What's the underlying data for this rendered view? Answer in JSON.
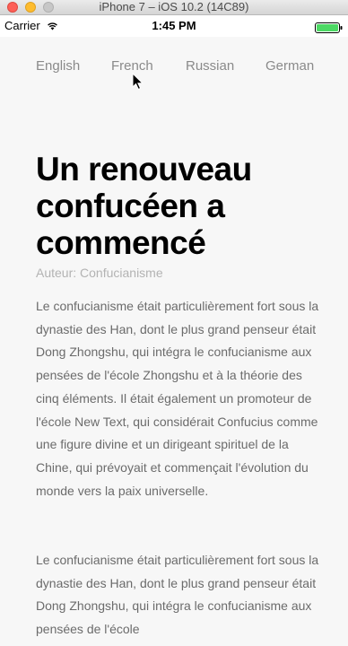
{
  "window": {
    "title": "iPhone 7 – iOS 10.2 (14C89)"
  },
  "status_bar": {
    "carrier": "Carrier",
    "time": "1:45 PM"
  },
  "languages": [
    "English",
    "French",
    "Russian",
    "German"
  ],
  "article": {
    "title": "Un renouveau confucéen a commencé",
    "author": "Auteur: Confucianisme",
    "paragraphs": [
      "Le confucianisme était particulièrement fort sous la dynastie des Han, dont le plus grand penseur était Dong Zhongshu, qui intégra le confucianisme aux pensées de l'école Zhongshu et à la théorie des cinq éléments. Il était également un promoteur de l'école New Text, qui considérait Confucius comme une figure divine et un dirigeant spirituel de la Chine, qui prévoyait et commençait l'évolution du monde vers la paix universelle.",
      "Le confucianisme était particulièrement fort sous la dynastie des Han, dont le plus grand penseur était Dong Zhongshu, qui intégra le confucianisme aux pensées de l'école"
    ]
  },
  "colors": {
    "battery": "#4cd964",
    "close": "#fd5f57",
    "minimize": "#febc2e"
  }
}
